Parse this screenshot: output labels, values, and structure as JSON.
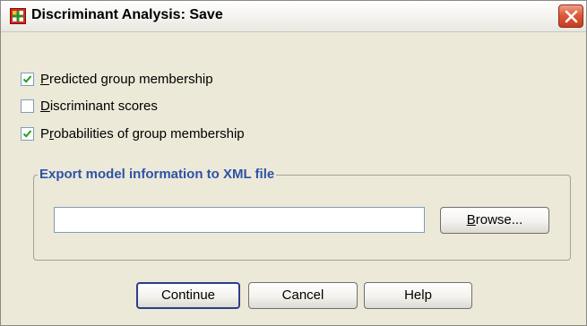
{
  "window": {
    "title": "Discriminant Analysis: Save"
  },
  "options": [
    {
      "prefix": "",
      "mnemonic": "P",
      "rest": "redicted group membership",
      "checked": true
    },
    {
      "prefix": "",
      "mnemonic": "D",
      "rest": "iscriminant scores",
      "checked": false
    },
    {
      "prefix": "P",
      "mnemonic": "r",
      "rest": "obabilities of group membership",
      "checked": true
    }
  ],
  "export": {
    "group_title": "Export model information to XML file",
    "file_value": "",
    "browse": {
      "mnemonic": "B",
      "rest": "rowse..."
    }
  },
  "buttons": {
    "continue": "Continue",
    "cancel": "Cancel",
    "help": "Help"
  },
  "colors": {
    "group_title": "#2d52a8",
    "close_button": "#e0583a",
    "dialog_bg": "#ece9d8"
  },
  "icons": [
    "app-icon",
    "close-icon",
    "checkmark-icon"
  ]
}
